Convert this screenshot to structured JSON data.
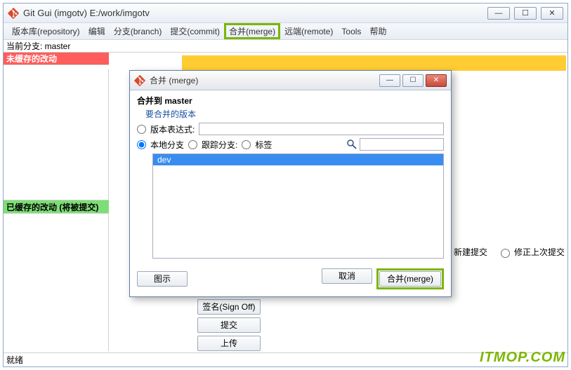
{
  "main_window": {
    "title": "Git Gui (imgotv) E:/work/imgotv",
    "minimize": "—",
    "maximize": "☐",
    "close": "✕"
  },
  "menubar": {
    "repository": "版本库(repository)",
    "edit": "编辑",
    "branch": "分支(branch)",
    "commit": "提交(commit)",
    "merge": "合并(merge)",
    "remote": "远端(remote)",
    "tools": "Tools",
    "help": "帮助"
  },
  "branch_bar": "当前分支: master",
  "panes": {
    "unstaged": "未缓存的改动",
    "staged": "已缓存的改动 (将被提交)"
  },
  "commit_mode": {
    "new": "新建提交",
    "amend": "修正上次提交"
  },
  "side_buttons": {
    "signoff": "签名(Sign Off)",
    "commit": "提交",
    "push": "上传"
  },
  "status": "就绪",
  "dialog": {
    "window_title": "合并 (merge)",
    "minimize": "—",
    "maximize": "☐",
    "close": "✕",
    "heading": "合并到 master",
    "rev_to_merge": "要合并的版本",
    "rev_expression": "版本表达式:",
    "expr_value": "",
    "local_branch": "本地分支",
    "tracking_branch": "跟踪分支:",
    "tag": "标签",
    "filter_value": "",
    "list": [
      "dev"
    ],
    "visualize": "图示",
    "cancel": "取消",
    "merge_btn": "合并(merge)"
  },
  "watermark": "ITMOP.COM"
}
